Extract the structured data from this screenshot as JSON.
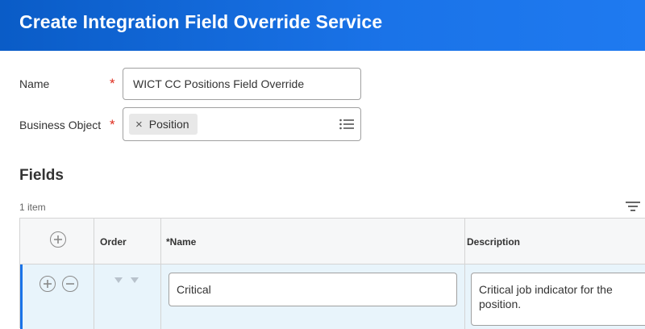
{
  "header": {
    "title": "Create Integration Field Override Service"
  },
  "form": {
    "name": {
      "label": "Name",
      "required_mark": "*",
      "value": "WICT CC Positions Field Override"
    },
    "business_object": {
      "label": "Business Object",
      "required_mark": "*",
      "selected": "Position",
      "remove_glyph": "×"
    }
  },
  "fields": {
    "title": "Fields",
    "item_count": "1 item",
    "columns": {
      "order": "Order",
      "name": "*Name",
      "description": "Description"
    },
    "rows": [
      {
        "name": "Critical",
        "description": "Critical job indicator for the position."
      }
    ]
  },
  "icons": {
    "prompt": "list-prompt-icon",
    "filter": "filter-lines-icon",
    "add": "plus-circle-icon",
    "remove": "minus-circle-icon",
    "sort": "sort-triangle-icon"
  },
  "colors": {
    "header": "#0a5cc7",
    "required": "#de2c1e",
    "row_highlight": "#e8f4fb",
    "row_accent": "#1a73e8"
  }
}
